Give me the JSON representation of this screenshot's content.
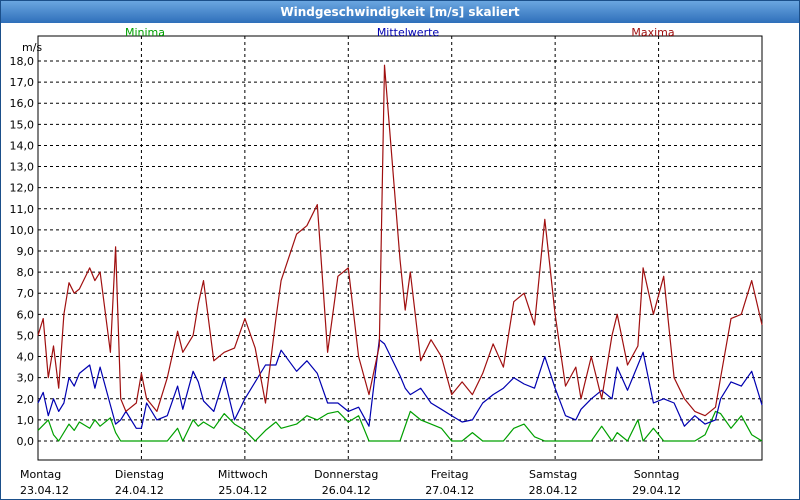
{
  "window": {
    "title": "Windgeschwindigkeit [m/s] skaliert"
  },
  "chart_data": {
    "type": "line",
    "title": "Windgeschwindigkeit [m/s] skaliert",
    "ylabel": "m/s",
    "ylim": [
      0,
      18
    ],
    "xlim": [
      0,
      7
    ],
    "grid": true,
    "legend_position": "top",
    "y_ticks": [
      "0,0",
      "1,0",
      "2,0",
      "3,0",
      "4,0",
      "5,0",
      "6,0",
      "7,0",
      "8,0",
      "9,0",
      "10,0",
      "11,0",
      "12,0",
      "13,0",
      "14,0",
      "15,0",
      "16,0",
      "17,0",
      "18,0"
    ],
    "days": [
      {
        "weekday": "Montag",
        "date": "23.04.12"
      },
      {
        "weekday": "Dienstag",
        "date": "24.04.12"
      },
      {
        "weekday": "Mittwoch",
        "date": "25.04.12"
      },
      {
        "weekday": "Donnerstag",
        "date": "26.04.12"
      },
      {
        "weekday": "Freitag",
        "date": "27.04.12"
      },
      {
        "weekday": "Samstag",
        "date": "28.04.12"
      },
      {
        "weekday": "Sonntag",
        "date": "29.04.12"
      }
    ],
    "series": [
      {
        "name": "Minima",
        "color": "#00a000",
        "x": [
          0,
          0.1,
          0.15,
          0.2,
          0.3,
          0.35,
          0.4,
          0.5,
          0.55,
          0.6,
          0.7,
          0.75,
          0.8,
          0.85,
          0.95,
          1.05,
          1.15,
          1.25,
          1.35,
          1.4,
          1.5,
          1.55,
          1.6,
          1.7,
          1.8,
          1.9,
          2.0,
          2.1,
          2.2,
          2.3,
          2.35,
          2.5,
          2.6,
          2.7,
          2.8,
          2.9,
          3.0,
          3.1,
          3.2,
          3.3,
          3.35,
          3.5,
          3.6,
          3.7,
          3.8,
          3.9,
          4.0,
          4.1,
          4.2,
          4.3,
          4.4,
          4.5,
          4.6,
          4.7,
          4.8,
          4.9,
          5.0,
          5.1,
          5.2,
          5.25,
          5.35,
          5.45,
          5.55,
          5.6,
          5.7,
          5.8,
          5.85,
          5.95,
          6.05,
          6.15,
          6.25,
          6.35,
          6.45,
          6.55,
          6.6,
          6.7,
          6.8,
          6.9,
          7.0
        ],
        "y": [
          0.5,
          1.0,
          0.3,
          0.0,
          0.8,
          0.5,
          0.9,
          0.6,
          1.0,
          0.7,
          1.1,
          0.4,
          0.0,
          0.0,
          0.0,
          0.0,
          0.0,
          0.0,
          0.6,
          0.0,
          1.0,
          0.7,
          0.9,
          0.6,
          1.3,
          0.8,
          0.5,
          0.0,
          0.5,
          0.9,
          0.6,
          0.8,
          1.2,
          1.0,
          1.3,
          1.4,
          0.9,
          1.2,
          0.0,
          0.0,
          0.0,
          0.0,
          1.4,
          1.0,
          0.8,
          0.6,
          0.0,
          0.0,
          0.4,
          0.0,
          0.0,
          0.0,
          0.6,
          0.8,
          0.2,
          0.0,
          0.0,
          0.0,
          0.0,
          0.0,
          0.0,
          0.7,
          0.0,
          0.4,
          0.0,
          1.0,
          0.0,
          0.6,
          0.0,
          0.0,
          0.0,
          0.0,
          0.3,
          1.4,
          1.3,
          0.6,
          1.2,
          0.3,
          0.0
        ]
      },
      {
        "name": "Mittelwerte",
        "color": "#0000b0",
        "x": [
          0,
          0.05,
          0.1,
          0.15,
          0.2,
          0.25,
          0.3,
          0.35,
          0.4,
          0.5,
          0.55,
          0.6,
          0.7,
          0.75,
          0.8,
          0.85,
          0.95,
          1.0,
          1.05,
          1.15,
          1.25,
          1.35,
          1.4,
          1.5,
          1.55,
          1.6,
          1.7,
          1.8,
          1.9,
          2.0,
          2.1,
          2.2,
          2.3,
          2.35,
          2.5,
          2.6,
          2.7,
          2.8,
          2.9,
          3.0,
          3.1,
          3.2,
          3.3,
          3.35,
          3.5,
          3.55,
          3.6,
          3.7,
          3.8,
          3.9,
          4.0,
          4.1,
          4.2,
          4.3,
          4.4,
          4.5,
          4.6,
          4.7,
          4.8,
          4.9,
          5.0,
          5.1,
          5.2,
          5.25,
          5.35,
          5.45,
          5.55,
          5.6,
          5.7,
          5.8,
          5.85,
          5.95,
          6.05,
          6.15,
          6.25,
          6.35,
          6.45,
          6.55,
          6.6,
          6.7,
          6.8,
          6.9,
          7.0
        ],
        "y": [
          1.8,
          2.3,
          1.2,
          2.0,
          1.4,
          1.8,
          3.0,
          2.6,
          3.2,
          3.6,
          2.5,
          3.5,
          1.7,
          0.8,
          1.0,
          1.4,
          0.6,
          0.6,
          1.8,
          1.0,
          1.2,
          2.6,
          1.5,
          3.3,
          2.8,
          1.9,
          1.4,
          3.0,
          1.0,
          2.0,
          2.8,
          3.6,
          3.6,
          4.3,
          3.3,
          3.8,
          3.2,
          1.8,
          1.8,
          1.4,
          1.6,
          0.7,
          4.8,
          4.6,
          3.1,
          2.5,
          2.2,
          2.5,
          1.8,
          1.5,
          1.2,
          0.9,
          1.0,
          1.8,
          2.2,
          2.5,
          3.0,
          2.7,
          2.5,
          4.0,
          2.5,
          1.2,
          1.0,
          1.5,
          2.0,
          2.4,
          2.0,
          3.5,
          2.4,
          3.6,
          4.2,
          1.8,
          2.0,
          1.8,
          0.7,
          1.2,
          0.8,
          1.0,
          2.0,
          2.8,
          2.6,
          3.3,
          1.7
        ]
      },
      {
        "name": "Maxima",
        "color": "#a01010",
        "x": [
          0,
          0.05,
          0.1,
          0.15,
          0.2,
          0.25,
          0.3,
          0.35,
          0.4,
          0.5,
          0.55,
          0.6,
          0.7,
          0.75,
          0.8,
          0.85,
          0.95,
          1.0,
          1.05,
          1.15,
          1.25,
          1.35,
          1.4,
          1.5,
          1.55,
          1.6,
          1.7,
          1.8,
          1.9,
          2.0,
          2.1,
          2.2,
          2.3,
          2.35,
          2.5,
          2.6,
          2.7,
          2.8,
          2.9,
          3.0,
          3.1,
          3.2,
          3.3,
          3.35,
          3.5,
          3.55,
          3.6,
          3.7,
          3.8,
          3.9,
          4.0,
          4.1,
          4.2,
          4.3,
          4.4,
          4.5,
          4.6,
          4.7,
          4.8,
          4.9,
          5.0,
          5.1,
          5.2,
          5.25,
          5.35,
          5.45,
          5.55,
          5.6,
          5.7,
          5.8,
          5.85,
          5.95,
          6.05,
          6.15,
          6.25,
          6.35,
          6.45,
          6.55,
          6.6,
          6.7,
          6.8,
          6.9,
          7.0
        ],
        "y": [
          5.0,
          5.8,
          3.0,
          4.5,
          2.5,
          6.0,
          7.5,
          7.0,
          7.2,
          8.2,
          7.6,
          8.0,
          4.2,
          9.2,
          2.0,
          1.4,
          1.8,
          3.2,
          2.0,
          1.4,
          3.0,
          5.2,
          4.2,
          5.0,
          6.5,
          7.6,
          3.8,
          4.2,
          4.4,
          5.8,
          4.4,
          1.8,
          5.8,
          7.6,
          9.8,
          10.2,
          11.2,
          4.2,
          7.8,
          8.2,
          4.0,
          2.2,
          4.5,
          17.8,
          8.6,
          6.2,
          8.0,
          3.8,
          4.8,
          4.0,
          2.2,
          2.8,
          2.2,
          3.2,
          4.6,
          3.5,
          6.6,
          7.0,
          5.5,
          10.5,
          6.0,
          2.6,
          3.5,
          2.0,
          4.0,
          2.0,
          5.0,
          6.0,
          3.6,
          4.5,
          8.2,
          6.0,
          7.8,
          3.0,
          2.0,
          1.4,
          1.2,
          1.6,
          3.0,
          5.8,
          6.0,
          7.6,
          5.5
        ]
      }
    ]
  }
}
